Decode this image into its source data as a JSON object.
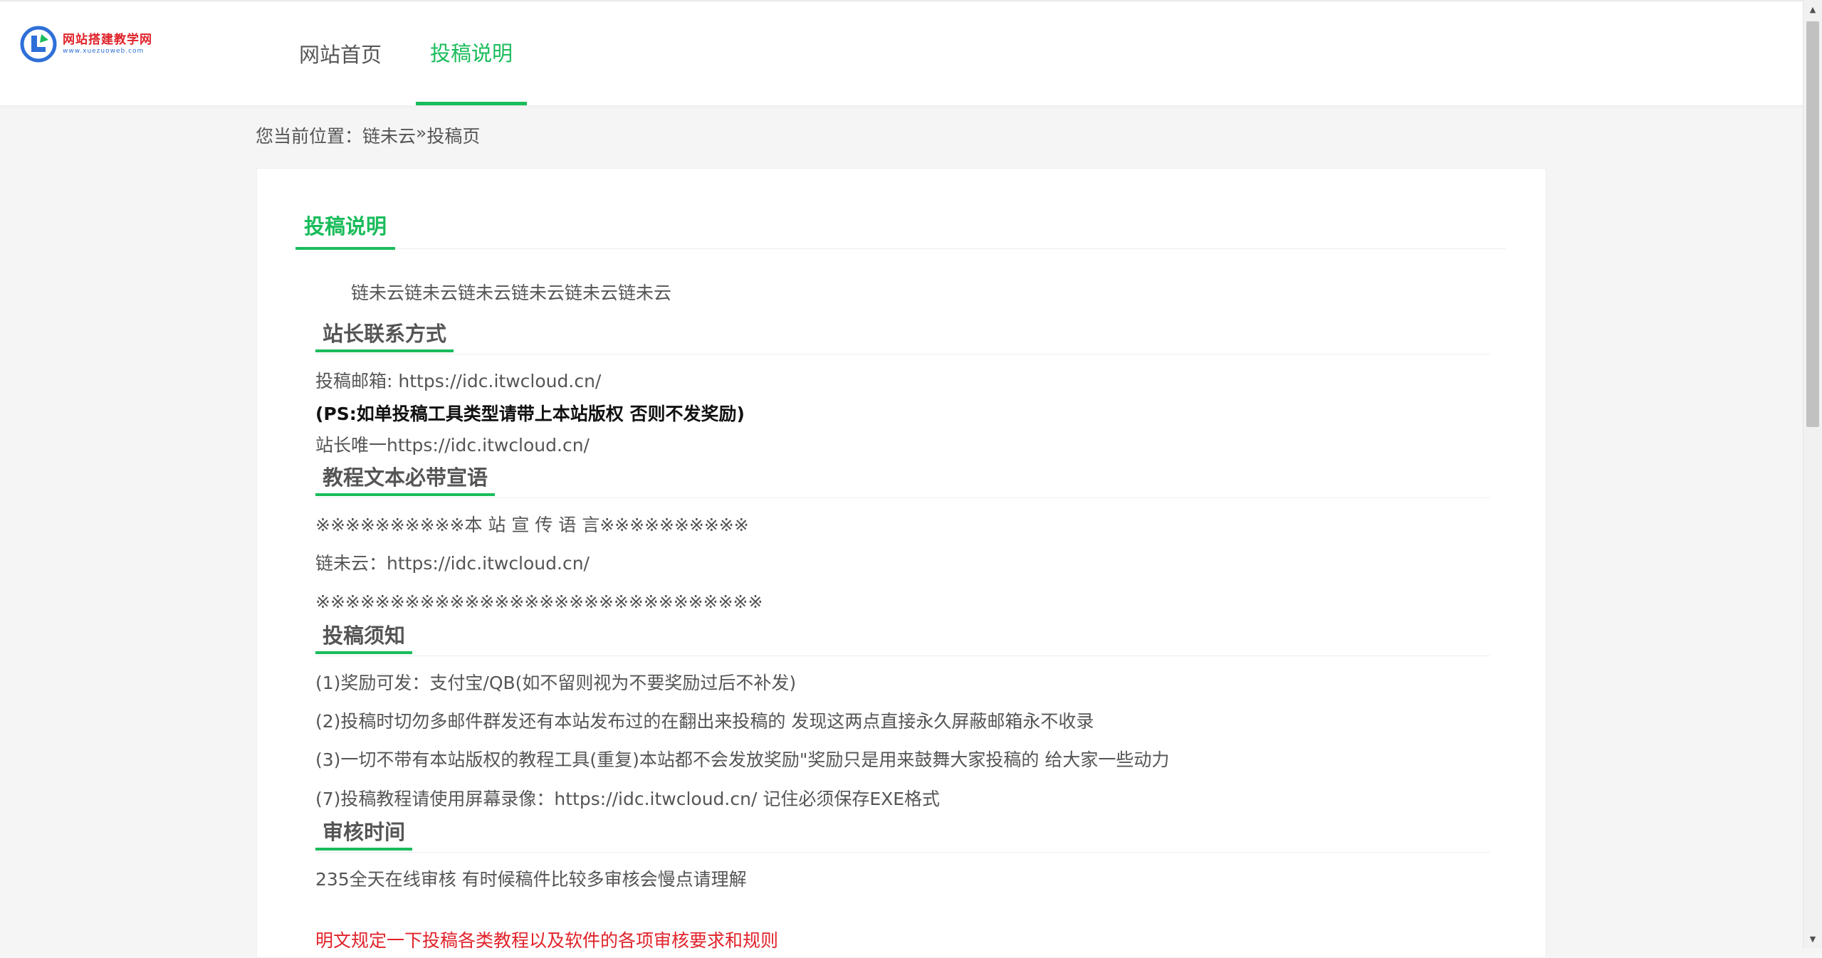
{
  "header": {
    "logo_title": "网站搭建教学网",
    "logo_sub": "www.xuezuoweb.com",
    "nav": [
      {
        "label": "网站首页",
        "active": false
      },
      {
        "label": "投稿说明",
        "active": true
      }
    ]
  },
  "breadcrumb": {
    "prefix": "您当前位置：",
    "home": "链未云",
    "separator": "»",
    "current": "投稿页"
  },
  "article": {
    "title": "投稿说明",
    "intro": "链未云链未云链未云链未云链未云链未云",
    "sections": [
      {
        "heading": "站长联系方式",
        "lines": [
          "投稿邮箱: https://idc.itwcloud.cn/",
          "(PS:如单投稿工具类型请带上本站版权 否则不发奖励)",
          "站长唯一https://idc.itwcloud.cn/"
        ]
      },
      {
        "heading": "教程文本必带宣语",
        "lines": [
          "※※※※※※※※※※本 站 宣 传 语 言※※※※※※※※※※",
          "链未云：https://idc.itwcloud.cn/",
          "※※※※※※※※※※※※※※※※※※※※※※※※※※※※※※"
        ]
      },
      {
        "heading": "投稿须知",
        "lines": [
          "(1)奖励可发：支付宝/QB(如不留则视为不要奖励过后不补发)",
          "(2)投稿时切勿多邮件群发还有本站发布过的在翻出来投稿的 发现这两点直接永久屏蔽邮箱永不收录",
          "(3)一切不带有本站版权的教程工具(重复)本站都不会发放奖励\"奖励只是用来鼓舞大家投稿的 给大家一些动力",
          "(7)投稿教程请使用屏幕录像：https://idc.itwcloud.cn/ 记住必须保存EXE格式"
        ]
      },
      {
        "heading": "审核时间",
        "lines": [
          "235全天在线审核 有时候稿件比较多审核会慢点请理解"
        ]
      }
    ],
    "notice": "明文规定一下投稿各类教程以及软件的各项审核要求和规则"
  },
  "colors": {
    "accent": "#1abc5b",
    "text": "#555555",
    "notice": "#e0222a",
    "page_bg": "#f5f5f5"
  }
}
